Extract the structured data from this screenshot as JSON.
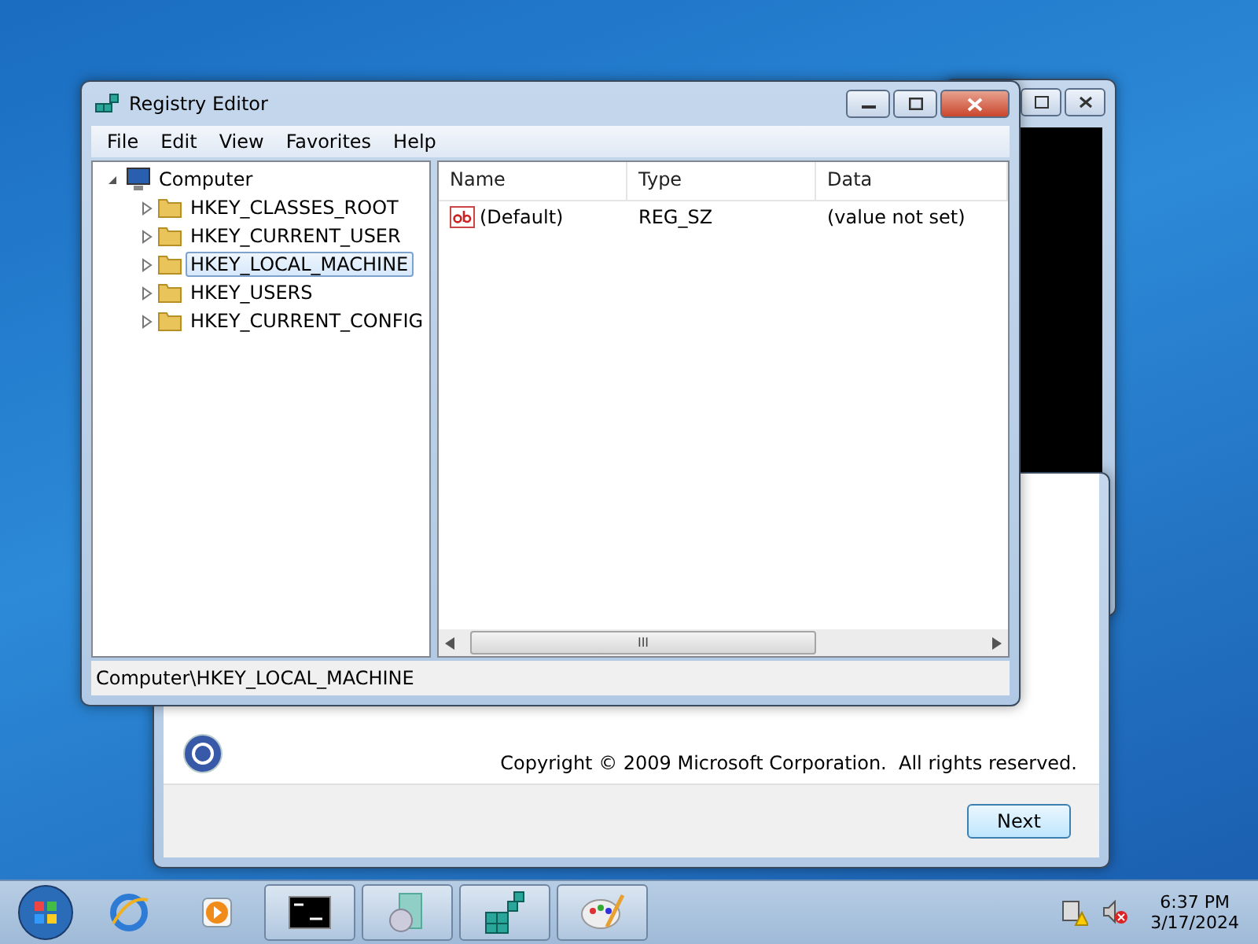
{
  "setup_window": {
    "copyright": "Copyright © 2009 Microsoft Corporation.  All rights reserved.",
    "button": "Next"
  },
  "registry_window": {
    "title": "Registry Editor",
    "menu": [
      "File",
      "Edit",
      "View",
      "Favorites",
      "Help"
    ],
    "tree": [
      {
        "label": "Computer",
        "expanded": true,
        "selected": false,
        "children": [
          {
            "label": "HKEY_CLASSES_ROOT",
            "expanded": false,
            "selected": false
          },
          {
            "label": "HKEY_CURRENT_USER",
            "expanded": false,
            "selected": false
          },
          {
            "label": "HKEY_LOCAL_MACHINE",
            "expanded": false,
            "selected": true
          },
          {
            "label": "HKEY_USERS",
            "expanded": false,
            "selected": false
          },
          {
            "label": "HKEY_CURRENT_CONFIG",
            "expanded": false,
            "selected": false
          }
        ]
      }
    ],
    "columns": [
      "Name",
      "Type",
      "Data"
    ],
    "rows": [
      {
        "name": "(Default)",
        "type": "REG_SZ",
        "data": "(value not set)"
      }
    ],
    "scrollbar_grip": "III",
    "status": "Computer\\HKEY_LOCAL_MACHINE"
  },
  "taskbar": {
    "items": [
      {
        "kind": "browser",
        "running": false
      },
      {
        "kind": "media",
        "running": false
      },
      {
        "kind": "console",
        "running": true
      },
      {
        "kind": "setup",
        "running": true
      },
      {
        "kind": "registry",
        "running": true
      },
      {
        "kind": "paint",
        "running": true
      }
    ],
    "time": "6:37 PM",
    "date": "3/17/2024"
  }
}
